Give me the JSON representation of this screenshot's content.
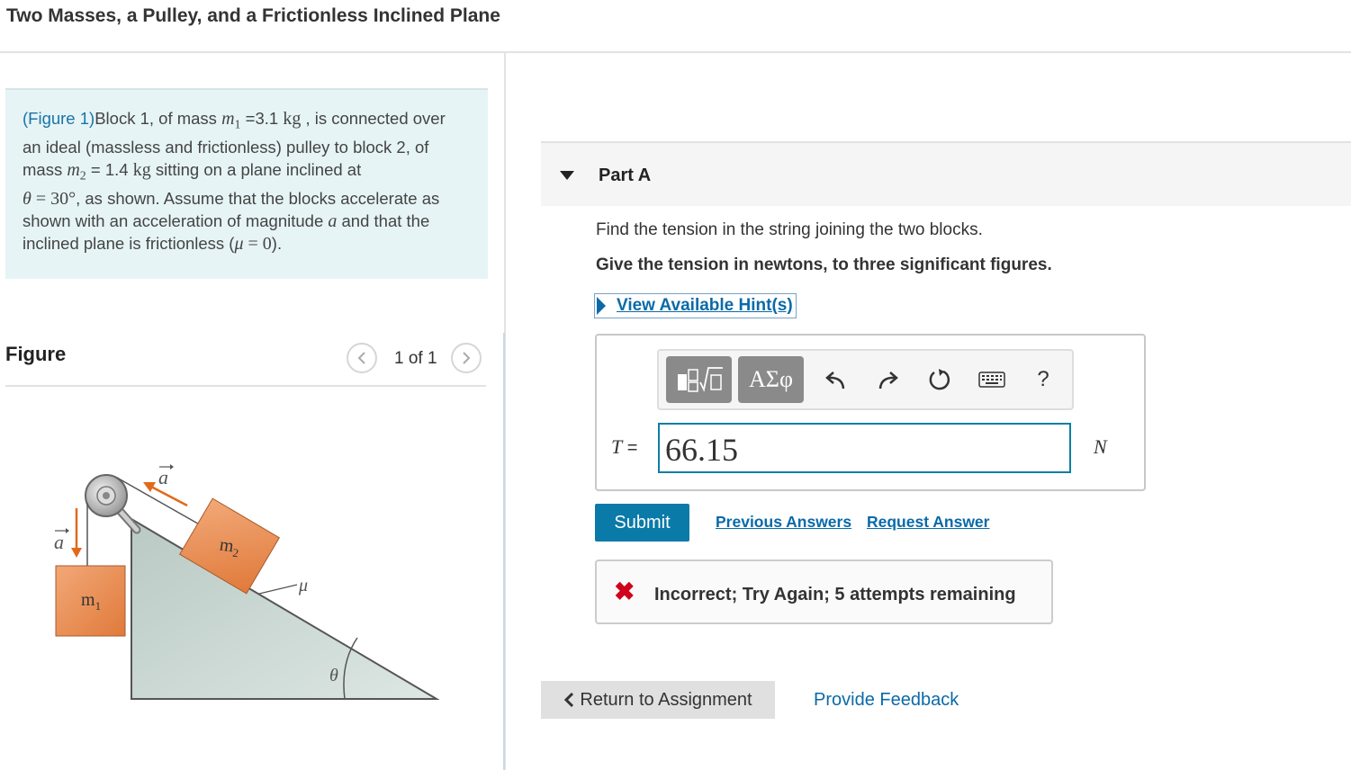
{
  "page": {
    "title": "Two Masses, a Pulley, and a Frictionless Inclined Plane"
  },
  "intro": {
    "figure_link": "(Figure 1)",
    "t1": "Block 1, of mass ",
    "m1_sym": "m",
    "m1_sub": "1",
    "t2": " =3.1 ",
    "unit_kg": "kg",
    "t3": " , is connected over an ideal (massless and frictionless) pulley to block 2, of mass ",
    "m2_sym": "m",
    "m2_sub": "2",
    "t4": " = 1.4 ",
    "unit_kg2": "kg",
    "t5": " sitting on a plane inclined at ",
    "theta_eq": "θ",
    "theta_val": " = 30°",
    "t6": ", as shown. Assume that the blocks accelerate as shown with an acceleration of magnitude ",
    "a_sym": "a",
    "t7": " and that the inclined plane is frictionless (",
    "mu_sym": "μ",
    "mu_val": " = 0",
    "t8": ")."
  },
  "figure": {
    "label": "Figure",
    "pager": "1 of 1",
    "prev_icon": "chevron-left-icon",
    "next_icon": "chevron-right-icon",
    "m1_label": "m",
    "m1_sub": "1",
    "m2_label": "m",
    "m2_sub": "2",
    "a_label_1": "a",
    "a_label_2": "a",
    "mu_label": "μ",
    "theta_label": "θ"
  },
  "partA": {
    "title": "Part A",
    "question": "Find the tension in the string joining the two blocks.",
    "instruction": "Give the tension in newtons, to three significant figures.",
    "hint_link": "View Available Hint(s)",
    "toolbar": {
      "templates_icon": "templates-icon",
      "greek_label": "ΑΣφ",
      "undo_icon": "undo-icon",
      "redo_icon": "redo-icon",
      "reset_icon": "reset-icon",
      "keyboard_icon": "keyboard-icon",
      "help_label": "?"
    },
    "answer_var": "T",
    "answer_eq": " =",
    "answer_value": "66.15",
    "unit": "N",
    "submit": "Submit",
    "previous_answers": "Previous Answers",
    "request_answer": "Request Answer",
    "feedback": "Incorrect; Try Again; 5 attempts remaining"
  },
  "footer": {
    "return": "Return to Assignment",
    "provide_feedback": "Provide Feedback"
  },
  "colors": {
    "link": "#0a6aa8",
    "submit_bg": "#0a7aa8",
    "intro_bg": "#e6f4f6",
    "error": "#d0021b",
    "block": "#e8894a"
  }
}
